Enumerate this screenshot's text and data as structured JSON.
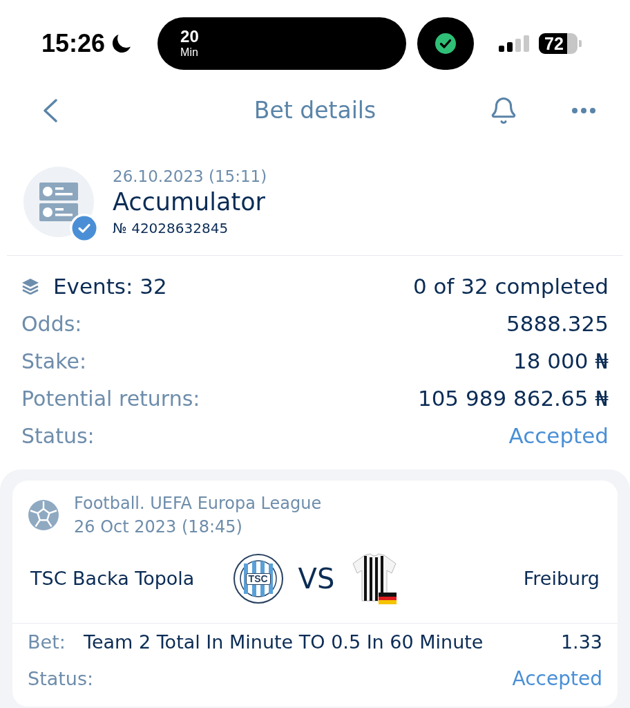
{
  "status_bar": {
    "time": "15:26",
    "activity_value": "20",
    "activity_unit": "Min",
    "battery": "72"
  },
  "header": {
    "title": "Bet details"
  },
  "bet": {
    "date": "26.10.2023 (15:11)",
    "type": "Accumulator",
    "number": "№ 42028632845"
  },
  "summary": [
    {
      "kind": "events",
      "label": "Events: 32",
      "value": "0 of 32 completed"
    },
    {
      "kind": "amount",
      "label": "Odds:",
      "value": "5888.325"
    },
    {
      "kind": "amount",
      "label": "Stake:",
      "value": "18 000 ₦"
    },
    {
      "kind": "amount",
      "label": "Potential returns:",
      "value": "105 989 862.65 ₦"
    },
    {
      "kind": "status",
      "label": "Status:",
      "value": "Accepted"
    }
  ],
  "events": [
    {
      "competition": "Football. UEFA Europa League",
      "date": "26 Oct 2023 (18:45)",
      "home": {
        "name": "TSC Backa Topola",
        "crest_text": "TSC"
      },
      "vs": "VS",
      "away": {
        "name": "Freiburg"
      },
      "bet_label": "Bet:",
      "bet": "Team 2 Total In Minute TO 0.5 In 60 Minute",
      "odds": "1.33",
      "status_label": "Status:",
      "status": "Accepted"
    }
  ]
}
